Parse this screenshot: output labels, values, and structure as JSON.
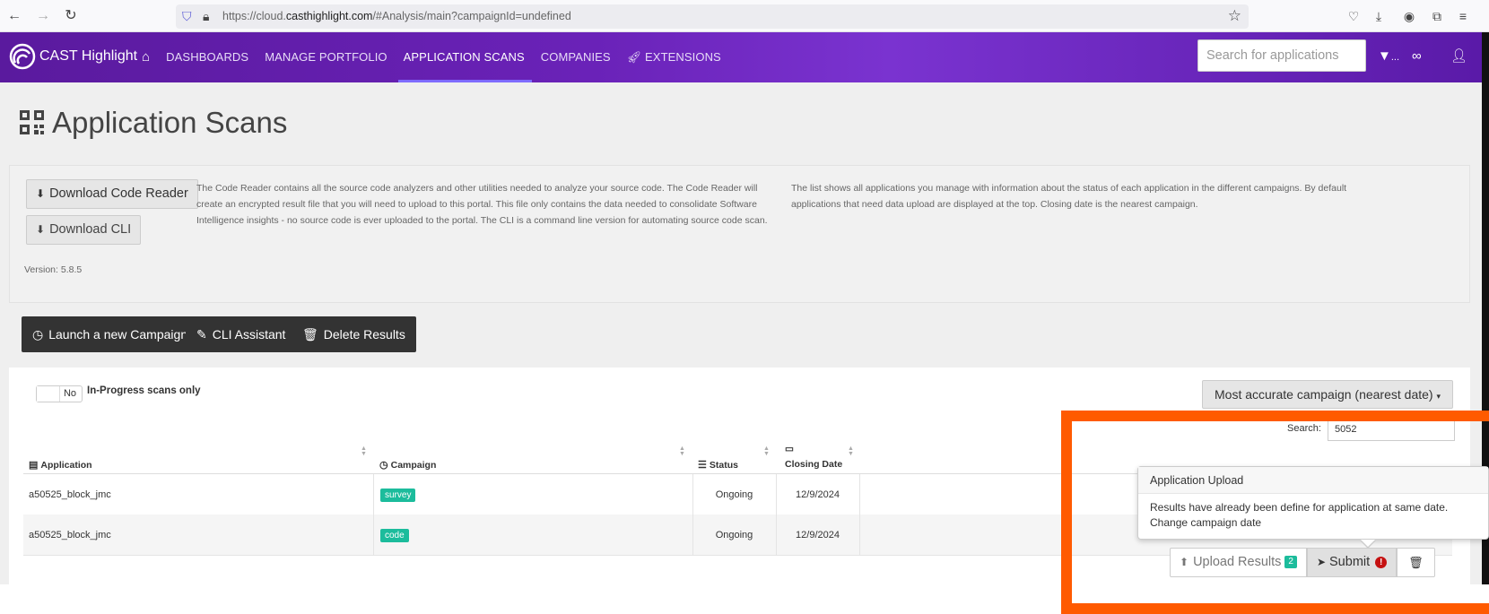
{
  "browser": {
    "url_prefix": "https://cloud.",
    "url_domain": "casthighlight.com",
    "url_suffix": "/#Analysis/main?campaignId=undefined"
  },
  "header": {
    "brand": "CAST Highlight",
    "nav": [
      {
        "label": "DASHBOARDS"
      },
      {
        "label": "MANAGE PORTFOLIO"
      },
      {
        "label": "APPLICATION SCANS"
      },
      {
        "label": "COMPANIES"
      },
      {
        "label": "EXTENSIONS"
      }
    ],
    "search_placeholder": "Search for applications",
    "filter_suffix": "..."
  },
  "page": {
    "title": "Application Scans",
    "download_code_reader": "Download Code Reader",
    "download_cli": "Download CLI",
    "info_left": "The Code Reader contains all the source code analyzers and other utilities needed to analyze your source code. The Code Reader will create an encrypted result file that you will need to upload to this portal. This file only contains the data needed to consolidate Software Intelligence insights - no source code is ever uploaded to the portal. The CLI is a command line version for automating source code scan.",
    "info_right": "The list shows all applications you manage with information about the status of each application in the different campaigns. By default applications that need data upload are displayed at the top. Closing date is the nearest campaign.",
    "version": "Version: 5.8.5",
    "actions": {
      "launch": "Launch a new Campaign",
      "cli_assistant": "CLI Assistant",
      "delete": "Delete Results"
    }
  },
  "table": {
    "toggle_value": "No",
    "toggle_label": "In-Progress scans only",
    "campaign_select": "Most accurate campaign (nearest date)",
    "search_label": "Search:",
    "search_value": "5052",
    "columns": {
      "application": "Application",
      "campaign": "Campaign",
      "status": "Status",
      "closing_date": "Closing Date"
    },
    "rows": [
      {
        "application": "a50525_block_jmc",
        "campaign": "survey",
        "status": "Ongoing",
        "closing_date": "12/9/2024"
      },
      {
        "application": "a50525_block_jmc",
        "campaign": "code",
        "status": "Ongoing",
        "closing_date": "12/9/2024"
      }
    ]
  },
  "popover": {
    "title": "Application Upload",
    "line1": "Results have already been define for application at same date.",
    "line2": "Change campaign date"
  },
  "row_actions": {
    "upload": "Upload Results",
    "upload_count": "2",
    "submit": "Submit",
    "error_mark": "!"
  },
  "colors": {
    "header_purple": "#6a22b8",
    "tag_green": "#1cbc9c",
    "highlight_orange": "#ff5a00",
    "error_red": "#c51111"
  }
}
